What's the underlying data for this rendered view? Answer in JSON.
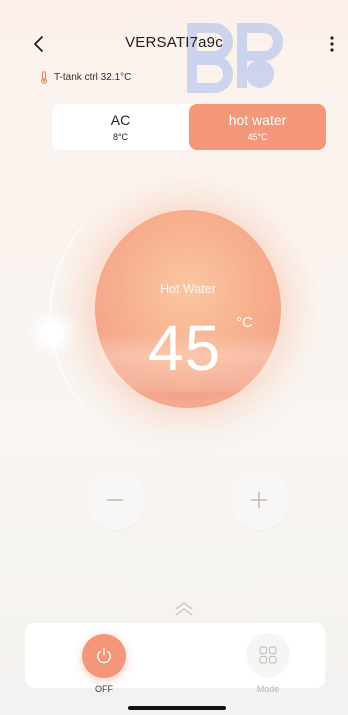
{
  "header": {
    "title": "VERSATI7a9c",
    "back_icon": "chevron-left-icon",
    "menu_icon": "more-vertical-icon",
    "watermark_icon": "brand-watermark-icon"
  },
  "status": {
    "tank_label": "T-tank ctrl 32.1°C",
    "thermo_icon": "thermometer-icon"
  },
  "modes": {
    "ac": {
      "label": "AC",
      "temp": "8°C"
    },
    "hot_water": {
      "label": "hot water",
      "temp": "45°C",
      "selected": true
    }
  },
  "dial": {
    "mode_label": "Hot Water",
    "temperature": "45",
    "unit": "°C"
  },
  "controls": {
    "minus_icon": "minus-icon",
    "plus_icon": "plus-icon",
    "expand_icon": "double-chevron-up-icon"
  },
  "bottom": {
    "power_label": "OFF",
    "power_icon": "power-icon",
    "mode_label": "Mode",
    "mode_icon": "grid-icon"
  },
  "colors": {
    "accent": "#f4967a",
    "ball": "#f7b08e",
    "background": "#faf3ee"
  }
}
